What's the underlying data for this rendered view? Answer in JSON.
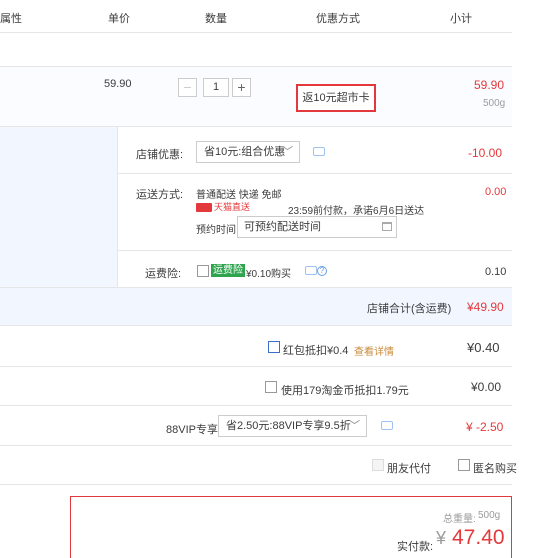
{
  "header": {
    "col_attr": "属性",
    "col_price": "单价",
    "col_qty": "数量",
    "col_promo": "优惠方式",
    "col_subtotal": "小计"
  },
  "item": {
    "price": "59.90",
    "qty": "1",
    "qty_minus": "−",
    "qty_plus": "+",
    "promo": "返10元超市卡",
    "subtotal": "59.90",
    "weight": "500g"
  },
  "shop": {
    "discount_label": "店铺优惠:",
    "discount_select": "省10元:组合优惠",
    "discount_value": "-10.00",
    "shipping_label": "运送方式:",
    "shipping_text": "普通配送 快递 免邮",
    "tmall_tag": "天猫直送",
    "delivery_note": "23:59前付款，承诺6月6日送达",
    "appointment_label": "预约时间",
    "appointment_placeholder": "可预约配送时间",
    "shipping_value": "0.00",
    "insurance_label": "运费险:",
    "insurance_tag": "运费险",
    "insurance_price": "¥0.10购买",
    "insurance_value": "0.10",
    "total_label": "店铺合计(含运费)",
    "total_value": "¥49.90"
  },
  "redpacket": {
    "label": "红包抵扣¥0.4",
    "link": "查看详情",
    "value": "¥0.40"
  },
  "coins": {
    "label": "使用179淘金币抵扣1.79元",
    "value": "¥0.00"
  },
  "vip": {
    "label": "88VIP专享",
    "select": "省2.50元:88VIP专享9.5折",
    "value": "¥ -2.50"
  },
  "options": {
    "friend_pay": "朋友代付",
    "anonymous": "匿名购买"
  },
  "summary": {
    "weight_label": "总重量:",
    "weight_value": "500g",
    "pay_label": "实付款:",
    "currency": "¥",
    "pay_value": "47.40"
  }
}
